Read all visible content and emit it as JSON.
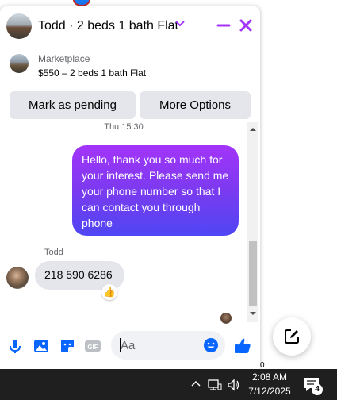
{
  "header": {
    "title": "Todd · 2 beds 1 bath Flat"
  },
  "listing": {
    "source": "Marketplace",
    "title": "$550 – 2 beds 1 bath Flat",
    "pending_label": "Mark as pending",
    "more_label": "More Options"
  },
  "conversation": {
    "timestamp": "Thu 15:30",
    "outgoing": "Hello, thank you so much for your interest. Please send me your phone number so that I can contact you through phone",
    "sender_name": "Todd",
    "incoming": "218 590 6286",
    "reaction": "👍"
  },
  "composer": {
    "placeholder": "Aa"
  },
  "taskbar": {
    "time": "2:08 AM",
    "date": "7/12/2025",
    "notification_count": "4"
  },
  "colors": {
    "accent": "#a334fa",
    "brand_blue": "#0866ff",
    "bubble_gradient_end": "#4f46f4"
  },
  "icons": [
    "chevron-down-icon",
    "minimize-icon",
    "close-icon",
    "microphone-icon",
    "photo-icon",
    "sticker-icon",
    "gif-icon",
    "emoji-icon",
    "thumbs-up-icon",
    "compose-icon",
    "network-icon",
    "volume-icon",
    "notifications-icon"
  ]
}
